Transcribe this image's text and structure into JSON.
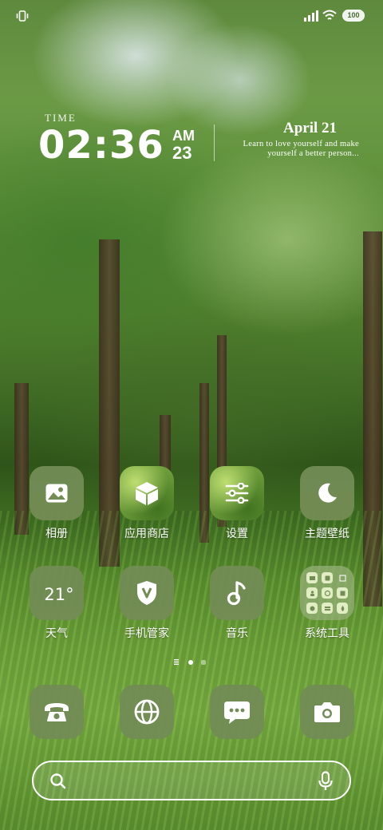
{
  "status_bar": {
    "battery": "100",
    "icons": [
      "vibrate-icon",
      "signal-icon",
      "wifi-icon",
      "battery-icon"
    ]
  },
  "clock_widget": {
    "label": "TIME",
    "time": "02:36",
    "ampm": "AM",
    "minute_small": "23",
    "date": "April 21",
    "quote_line1": "Learn to love yourself and make",
    "quote_line2": "yourself a better person..."
  },
  "apps_row1": [
    {
      "label": "相册",
      "icon": "gallery-icon"
    },
    {
      "label": "应用商店",
      "icon": "app-store-icon"
    },
    {
      "label": "设置",
      "icon": "settings-icon"
    },
    {
      "label": "主题壁纸",
      "icon": "theme-icon"
    }
  ],
  "apps_row2": [
    {
      "label": "天气",
      "icon": "weather-icon",
      "temp": "21°"
    },
    {
      "label": "手机管家",
      "icon": "phone-manager-icon"
    },
    {
      "label": "音乐",
      "icon": "music-icon"
    },
    {
      "label": "系统工具",
      "icon": "folder-icon"
    }
  ],
  "page_indicator": {
    "current": 1,
    "total": 2
  },
  "dock": [
    {
      "icon": "phone-icon"
    },
    {
      "icon": "browser-icon"
    },
    {
      "icon": "messages-icon"
    },
    {
      "icon": "camera-icon"
    }
  ],
  "search": {
    "placeholder": "",
    "value": ""
  },
  "colors": {
    "tile": "#738c55",
    "text": "#ffffff"
  }
}
